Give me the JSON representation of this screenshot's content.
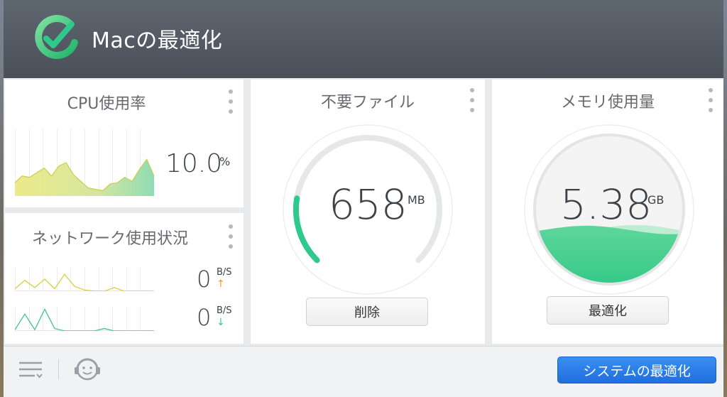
{
  "app": {
    "title": "Macの最適化"
  },
  "colors": {
    "accent": "#2fc98b",
    "primary": "#1f6fde",
    "warn": "#e8a317"
  },
  "cpu": {
    "title": "CPU使用率",
    "value": "10.0",
    "unit": "%",
    "history": [
      0.2,
      0.3,
      0.28,
      0.35,
      0.42,
      0.3,
      0.45,
      0.5,
      0.32,
      0.22,
      0.12,
      0.1,
      0.08,
      0.18,
      0.2,
      0.28,
      0.22,
      0.4,
      0.55,
      0.3
    ]
  },
  "network": {
    "title": "ネットワーク使用状況",
    "upload": {
      "value": "0",
      "unit": "B/S",
      "history": [
        0.1,
        0.45,
        0.15,
        0.5,
        0.1,
        0.7,
        0.2,
        0.05,
        0.0,
        0.0,
        0.15,
        0.0,
        0.0,
        0.0,
        0.0
      ]
    },
    "download": {
      "value": "0",
      "unit": "B/S",
      "history": [
        0.05,
        0.7,
        0.05,
        0.9,
        0.1,
        0.0,
        0.0,
        0.0,
        0.0,
        0.1,
        0.0,
        0.0,
        0.0,
        0.0,
        0.0
      ]
    }
  },
  "junk": {
    "title": "不要ファイル",
    "value": "658",
    "unit": "MB",
    "gauge_fraction": 0.2,
    "button": "削除"
  },
  "memory": {
    "title": "メモリ使用量",
    "value": "5.38",
    "unit": "GB",
    "fill_fraction": 0.36,
    "button": "最適化"
  },
  "footer": {
    "menu_icon": "list-icon",
    "support_icon": "support-smiley-icon",
    "primary_button": "システムの最適化"
  }
}
